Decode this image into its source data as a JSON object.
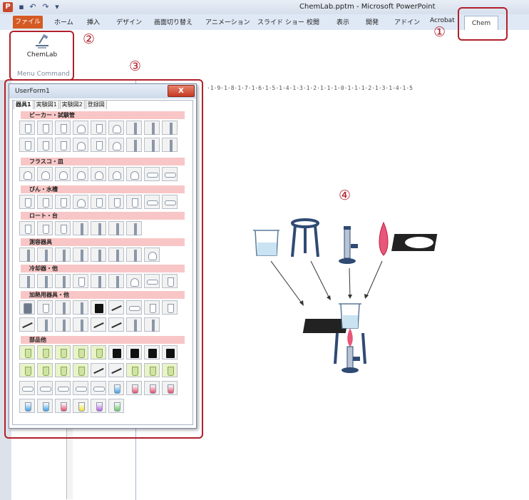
{
  "window": {
    "title": "ChemLab.pptm - Microsoft PowerPoint",
    "app_icon": "P",
    "quick_access": [
      "save-icon",
      "undo-icon",
      "redo-icon",
      "customize-icon"
    ]
  },
  "ribbon": {
    "tabs": [
      "ホーム",
      "挿入",
      "デザイン",
      "画面切り替え",
      "アニメーション",
      "スライド ショー",
      "校閲",
      "表示",
      "開発",
      "アドイン",
      "Acrobat"
    ],
    "file_tab": "ファイル",
    "active_tab": "Chem",
    "button_label": "ChemLab",
    "group_label": "Menu Command"
  },
  "annotations": {
    "m1": "①",
    "m2": "②",
    "m3": "③",
    "m4": "④"
  },
  "ruler_text": "·1·9·1·8·1·7·1·6·1·5·1·4·1·3·1·2·1·1·1·0·1·1·1·2·1·3·1·4·1·5",
  "userform": {
    "title": "UserForm1",
    "close": "X",
    "tabs": [
      "器具1",
      "実験図1",
      "実験図2",
      "登録図"
    ],
    "categories": [
      {
        "label": "ビーカー・試験管"
      },
      {
        "label": "フラスコ・皿"
      },
      {
        "label": "びん・水槽"
      },
      {
        "label": "ロート・台"
      },
      {
        "label": "測容器具"
      },
      {
        "label": "冷却器・他"
      },
      {
        "label": "加熱用器具・他"
      },
      {
        "label": "部品他"
      }
    ]
  },
  "colors": {
    "accent_red": "#b0202a",
    "file_tab": "#d45a23",
    "category_bg": "#f8c6c6"
  }
}
